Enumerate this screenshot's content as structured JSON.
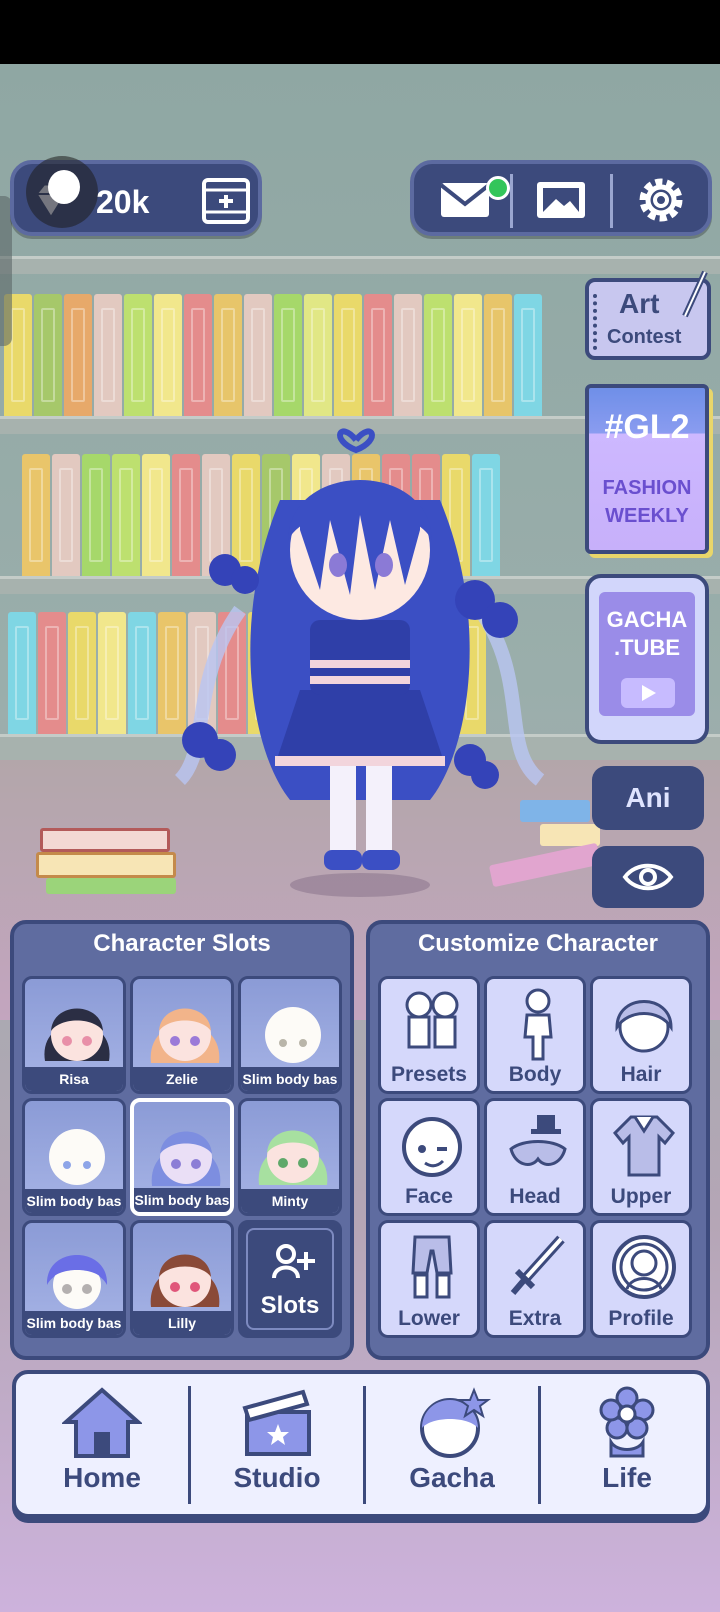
{
  "hud": {
    "gems": "20k"
  },
  "side": {
    "art_contest_line1": "Art",
    "art_contest_line2": "Contest",
    "fashion_tag": "#GL2",
    "fashion_line1": "FASHION",
    "fashion_line2": "WEEKLY",
    "gacha_tube_line1": "GACHA",
    "gacha_tube_line2": ".TUBE",
    "ani_label": "Ani"
  },
  "slots_panel": {
    "title": "Character Slots",
    "slots": [
      {
        "name": "Risa"
      },
      {
        "name": "Zelie"
      },
      {
        "name": "Slim body bas"
      },
      {
        "name": "Slim body bas"
      },
      {
        "name": "Slim body bas"
      },
      {
        "name": "Minty"
      },
      {
        "name": "Slim body bas"
      },
      {
        "name": "Lilly"
      }
    ],
    "add_label": "Slots"
  },
  "customize_panel": {
    "title": "Customize Character",
    "items": [
      {
        "label": "Presets"
      },
      {
        "label": "Body"
      },
      {
        "label": "Hair"
      },
      {
        "label": "Face"
      },
      {
        "label": "Head"
      },
      {
        "label": "Upper"
      },
      {
        "label": "Lower"
      },
      {
        "label": "Extra"
      },
      {
        "label": "Profile"
      }
    ]
  },
  "bottom_nav": {
    "items": [
      {
        "label": "Home",
        "icon": "house-icon"
      },
      {
        "label": "Studio",
        "icon": "clapperboard-icon"
      },
      {
        "label": "Gacha",
        "icon": "gacha-ball-icon"
      },
      {
        "label": "Life",
        "icon": "flower-icon"
      }
    ]
  },
  "colors": {
    "navy": "#3c4a7c",
    "panel": "#5f6ca0",
    "tile": "#d5d8fb",
    "notification": "#33c55a"
  }
}
